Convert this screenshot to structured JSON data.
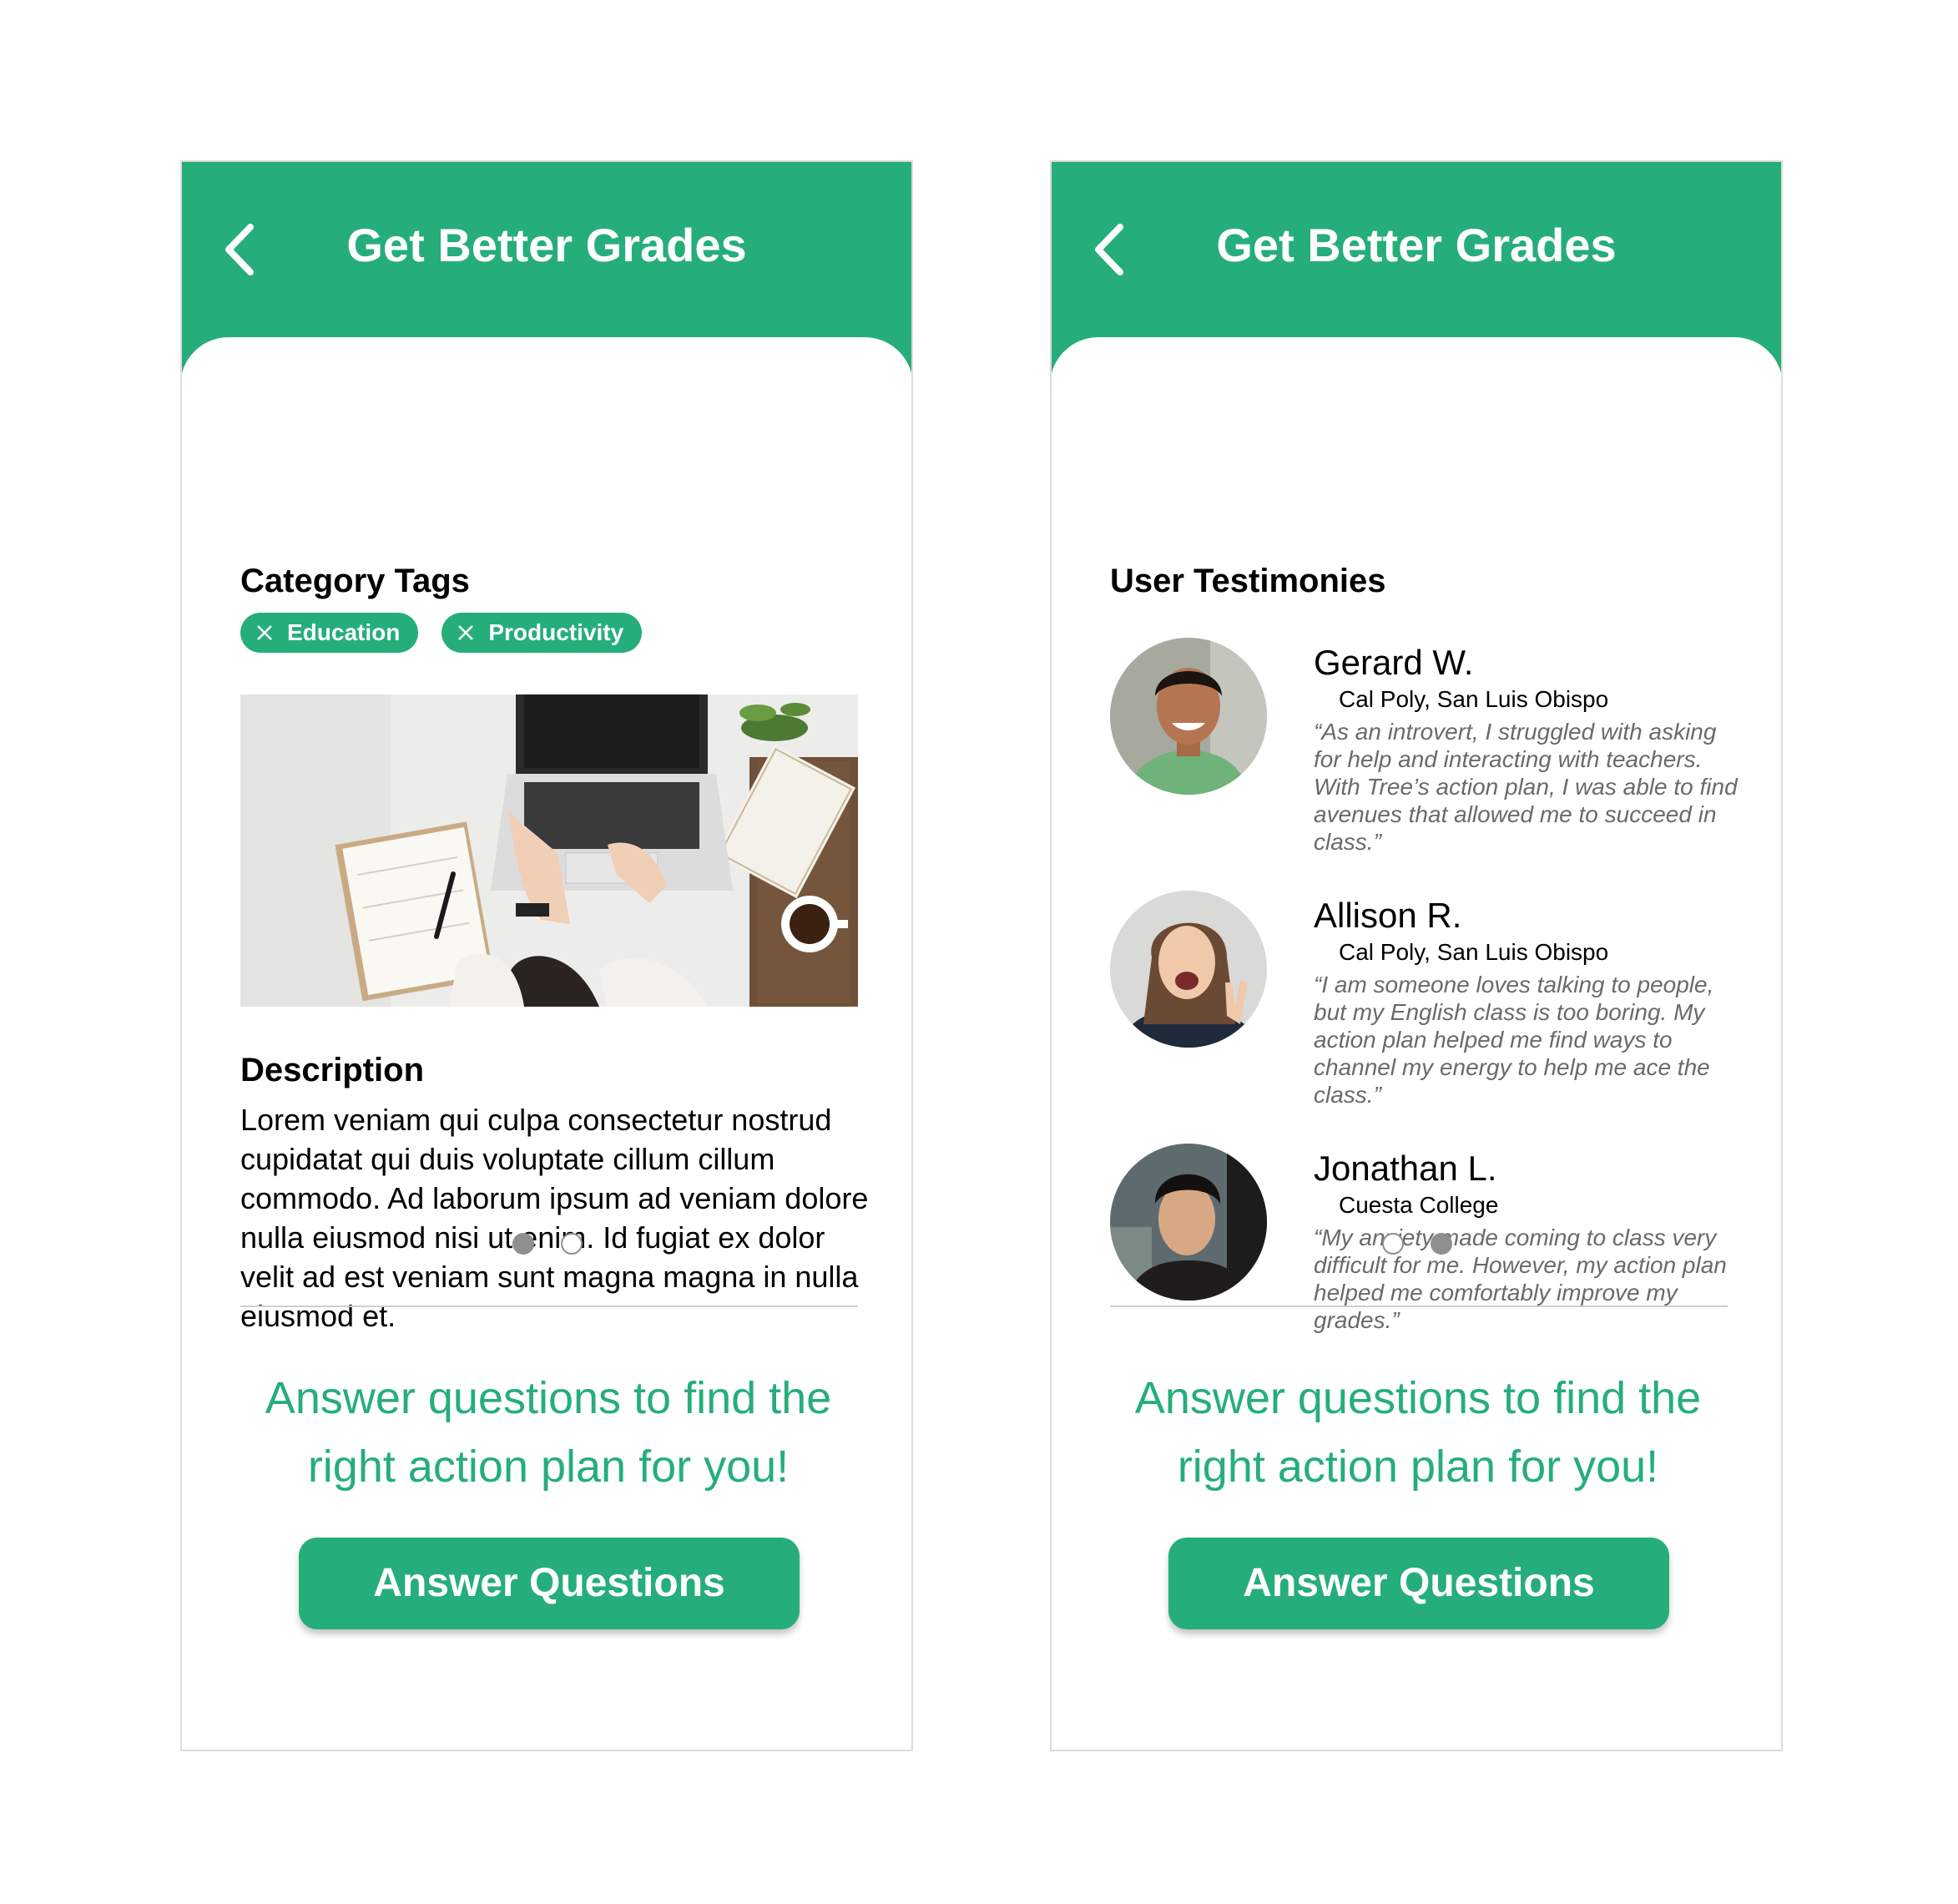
{
  "colors": {
    "accent": "#26AE7A",
    "dot": "#8f8f8f",
    "quote": "#6a6a6a"
  },
  "screens": [
    {
      "header": {
        "title": "Get Better Grades",
        "back_icon": "chevron-left-icon"
      },
      "category_section": {
        "title": "Category Tags",
        "tags": [
          {
            "label": "Education"
          },
          {
            "label": "Productivity"
          }
        ]
      },
      "photo": {
        "description": "laptop-workspace-photo"
      },
      "description_section": {
        "title": "Description",
        "text": "Lorem veniam qui culpa consectetur nostrud cupidatat qui duis voluptate cillum cillum commodo. Ad laborum ipsum ad veniam dolore nulla eiusmod nisi ut enim. Id fugiat ex dolor velit ad est veniam sunt magna magna in nulla eiusmod et."
      },
      "pagination": {
        "total": 2,
        "active": 1
      },
      "cta": {
        "text": "Answer questions to find the right action plan for you!",
        "button_label": "Answer Questions"
      }
    },
    {
      "header": {
        "title": "Get Better Grades",
        "back_icon": "chevron-left-icon"
      },
      "testimonies_section": {
        "title": "User Testimonies",
        "items": [
          {
            "name": "Gerard W.",
            "school": "Cal Poly, San Luis Obispo",
            "quote": "“As an introvert, I struggled with asking for help and interacting with teachers. With Tree’s action plan, I was able to find avenues that allowed me to succeed in class.”"
          },
          {
            "name": "Allison R.",
            "school": "Cal Poly, San Luis Obispo",
            "quote": "“I am someone loves talking to people, but my English class is too boring. My action plan helped me find ways to channel my energy to help me ace the class.”"
          },
          {
            "name": "Jonathan L.",
            "school": "Cuesta College",
            "quote": "“My anxiety made coming to class very difficult for me. However, my action plan helped me comfortably improve my grades.”"
          }
        ]
      },
      "pagination": {
        "total": 2,
        "active": 2
      },
      "cta": {
        "text": "Answer questions to find the right action plan for you!",
        "button_label": "Answer Questions"
      }
    }
  ]
}
